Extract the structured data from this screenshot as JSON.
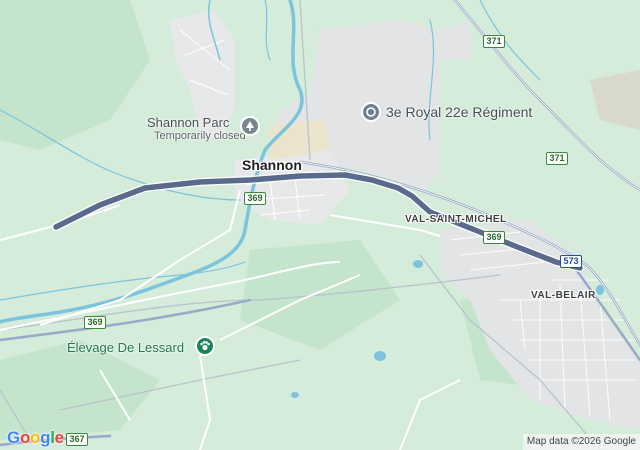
{
  "map": {
    "labels": {
      "shannon": "Shannon",
      "shannon_parc": "Shannon Parc",
      "shannon_parc_status": "Temporarily closed",
      "military_base": "3e Royal 22e Régiment",
      "val_saint_michel": "VAL-SAINT-MICHEL",
      "val_belair": "VAL-BELAIR",
      "elevage": "Élevage De Lessard"
    },
    "shields": {
      "r371_top": "371",
      "r371_right": "371",
      "r369_shannon": "369",
      "r369_valsm": "369",
      "r369_west": "369",
      "r367": "367",
      "a573": "573"
    },
    "icons": {
      "shannon_parc": "park-icon",
      "military_base": "military-pin-icon",
      "elevage": "farm-icon"
    },
    "colors": {
      "land": "#d4ecd9",
      "urban": "#e2e4e6",
      "water": "#7cc4de",
      "route": "#5a6a8c",
      "road": "#ffffff",
      "highway": "#9aa9c9"
    }
  },
  "branding": {
    "logo": "Google",
    "attribution": "Map data ©2026 Google"
  }
}
